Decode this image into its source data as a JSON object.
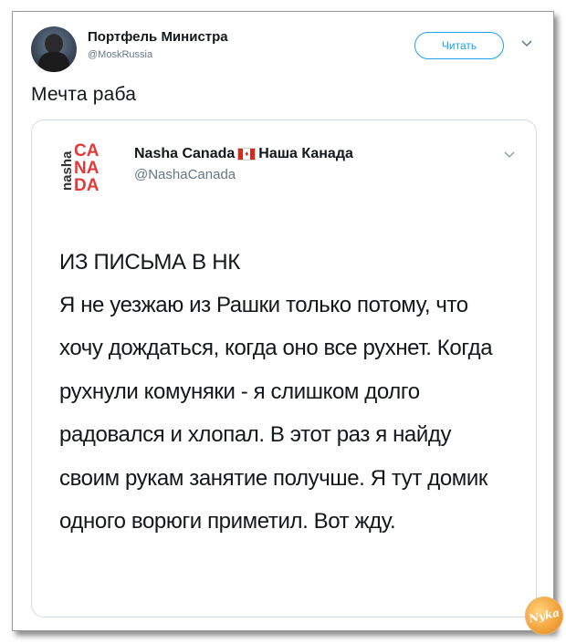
{
  "tweet": {
    "author_name": "Портфель Министра",
    "author_handle": "@MoskRussia",
    "follow_label": "Читать",
    "text": "Мечта раба"
  },
  "quoted_tweet": {
    "author_name": "Nasha Canada",
    "author_name_cyr": "Наша Канада",
    "author_handle": "@NashaCanada",
    "logo_side_text": "nasha",
    "logo_text_1": "CA",
    "logo_text_2": "NA",
    "logo_text_3": "DA",
    "heading": "ИЗ ПИСЬМА В НК",
    "body": "Я не уезжаю из Рашки только потому, что хочу дождаться, когда оно все рухнет. Когда рухнули комуняки - я слишком долго радовался и хлопал. В этот раз я найду своим рукам занятие получше. Я тут домик одного ворюги приметил. Вот жду."
  },
  "watermark": {
    "text": "Nyka"
  },
  "colors": {
    "accent": "#1da1f2",
    "logo_red": "#e23a3a",
    "secondary_text": "#657786"
  },
  "icons": {
    "menu": "chevron-down-icon",
    "flag": "canada-flag-icon"
  }
}
